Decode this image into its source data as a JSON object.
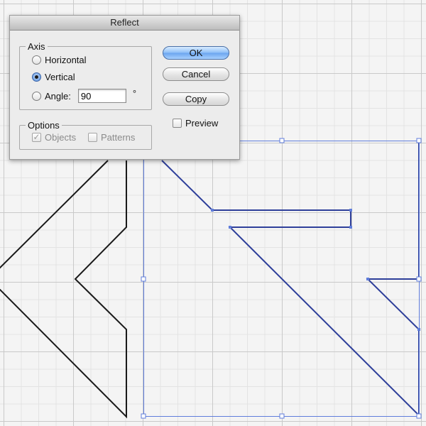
{
  "dialog": {
    "title": "Reflect",
    "axis": {
      "label": "Axis",
      "options": [
        "Horizontal",
        "Vertical"
      ],
      "selected": "Vertical",
      "angle_label": "Angle:",
      "angle_value": "90",
      "degree_symbol": "°"
    },
    "options": {
      "label": "Options",
      "objects_label": "Objects",
      "objects_checked": true,
      "patterns_label": "Patterns",
      "patterns_checked": false
    },
    "buttons": {
      "ok": "OK",
      "cancel": "Cancel",
      "copy": "Copy"
    },
    "preview_label": "Preview",
    "preview_checked": false
  },
  "canvas": {
    "stroke_color": "#1a1a1a",
    "selected_stroke_color": "#2e3f9a",
    "selection_color": "#5f7ddb",
    "grid_major_color": "#c9c9c9",
    "grid_minor_color": "#e3e3e3",
    "background": "#f4f4f4"
  }
}
